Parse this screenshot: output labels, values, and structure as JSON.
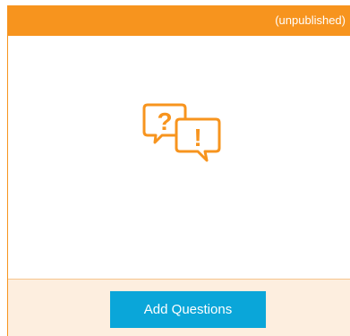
{
  "header": {
    "status": "(unpublished)",
    "background_color": "#f7941e"
  },
  "body": {
    "icon": "question-exclamation-bubbles-icon",
    "icon_color": "#f7941e"
  },
  "footer": {
    "background_color": "#fdeedf",
    "add_button_label": "Add Questions",
    "add_button_color": "#0aa6d9"
  }
}
